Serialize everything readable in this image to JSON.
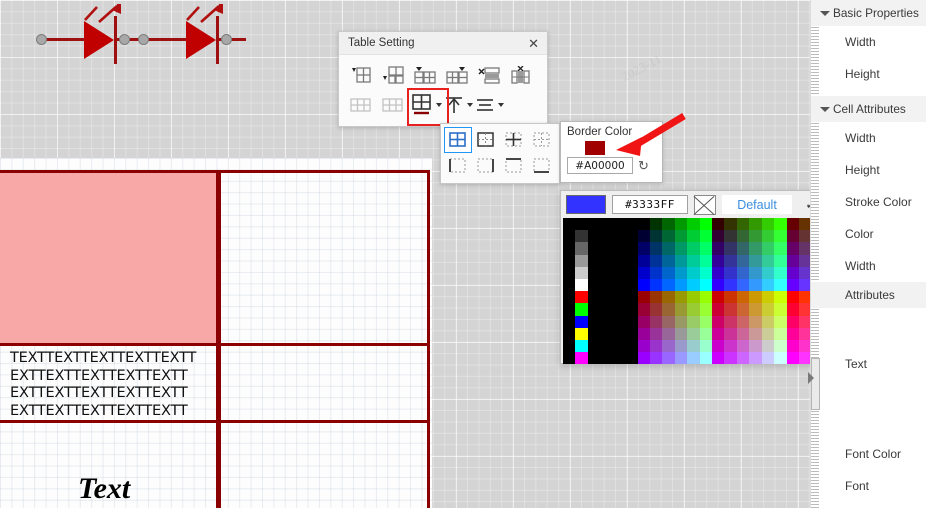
{
  "canvas": {
    "symbols": [
      {
        "name": "led-symbol-1"
      },
      {
        "name": "led-symbol-2"
      }
    ],
    "table": {
      "cell_text": "TEXTTEXTTEXTTEXTTEXTT\nEXTTEXTTEXTTEXTTEXTT\nEXTTEXTTEXTTEXTTEXTT\nEXTTEXTTEXTTEXTTEXTT",
      "cell_text_big": "Text",
      "fill_color": "#f9a8a8",
      "border_color": "#8b0000"
    }
  },
  "dialog": {
    "title": "Table Setting",
    "close_label": "✕",
    "row1": [
      {
        "name": "insert-column-left-icon"
      },
      {
        "name": "insert-row-above-icon"
      },
      {
        "name": "insert-column-right-icon"
      },
      {
        "name": "insert-row-below-icon"
      },
      {
        "name": "delete-row-icon"
      },
      {
        "name": "delete-column-icon"
      }
    ],
    "row2": [
      {
        "name": "merge-cells-icon"
      },
      {
        "name": "split-cells-icon"
      },
      {
        "name": "border-style-icon"
      },
      {
        "name": "vertical-align-icon"
      },
      {
        "name": "horizontal-align-icon"
      }
    ]
  },
  "border_flyout": {
    "options": [
      {
        "name": "border-all-icon",
        "active": true
      },
      {
        "name": "border-outer-icon",
        "active": false
      },
      {
        "name": "border-inner-icon",
        "active": false
      },
      {
        "name": "border-none-icon",
        "active": false
      },
      {
        "name": "border-left-icon",
        "active": false
      },
      {
        "name": "border-right-icon",
        "active": false
      },
      {
        "name": "border-top-icon",
        "active": false
      },
      {
        "name": "border-bottom-icon",
        "active": false
      }
    ]
  },
  "border_color_popup": {
    "label": "Border Color",
    "swatch": "#A00000",
    "hex_value": "#A00000",
    "reset_label": "↻"
  },
  "color_picker": {
    "current_color": "#3333FF",
    "hex_value": "#3333FF",
    "no_color_label": "",
    "default_label": "Default",
    "confirm_label": "✓",
    "cancel_label": "✕",
    "palette_rows": [
      [
        "#000000",
        "#000000",
        "#000000",
        "#000000",
        "#000000",
        "#000000",
        "#000000",
        "#003300",
        "#006600",
        "#009900",
        "#00cc00",
        "#00ff00",
        "#330000",
        "#333300",
        "#336600",
        "#339900",
        "#33cc00",
        "#33ff00",
        "#660000",
        "#663300",
        "#666600",
        "#669900",
        "#66cc00",
        "#66ff00"
      ],
      [
        "#000000",
        "#333333",
        "#000000",
        "#000000",
        "#000000",
        "#000000",
        "#000033",
        "#003333",
        "#006633",
        "#009933",
        "#00cc33",
        "#00ff33",
        "#330033",
        "#333333",
        "#336633",
        "#339933",
        "#33cc33",
        "#33ff33",
        "#660033",
        "#663333",
        "#666633",
        "#669933",
        "#66cc33",
        "#66ff33"
      ],
      [
        "#000000",
        "#666666",
        "#000000",
        "#000000",
        "#000000",
        "#000000",
        "#000066",
        "#003366",
        "#006666",
        "#009966",
        "#00cc66",
        "#00ff66",
        "#330066",
        "#333366",
        "#336666",
        "#339966",
        "#33cc66",
        "#33ff66",
        "#660066",
        "#663366",
        "#666666",
        "#669966",
        "#66cc66",
        "#66ff66"
      ],
      [
        "#000000",
        "#999999",
        "#000000",
        "#000000",
        "#000000",
        "#000000",
        "#000099",
        "#003399",
        "#006699",
        "#009999",
        "#00cc99",
        "#00ff99",
        "#330099",
        "#333399",
        "#336699",
        "#339999",
        "#33cc99",
        "#33ff99",
        "#660099",
        "#663399",
        "#666699",
        "#669999",
        "#66cc99",
        "#66ff99"
      ],
      [
        "#000000",
        "#cccccc",
        "#000000",
        "#000000",
        "#000000",
        "#000000",
        "#0000cc",
        "#0033cc",
        "#0066cc",
        "#0099cc",
        "#00cccc",
        "#00ffcc",
        "#3300cc",
        "#3333cc",
        "#3366cc",
        "#3399cc",
        "#33cccc",
        "#33ffcc",
        "#6600cc",
        "#6633cc",
        "#6666cc",
        "#6699cc",
        "#66cccc",
        "#66ffcc"
      ],
      [
        "#000000",
        "#ffffff",
        "#000000",
        "#000000",
        "#000000",
        "#000000",
        "#0000ff",
        "#0033ff",
        "#0066ff",
        "#0099ff",
        "#00ccff",
        "#00ffff",
        "#3300ff",
        "#3333ff",
        "#3366ff",
        "#3399ff",
        "#33ccff",
        "#33ffff",
        "#6600ff",
        "#6633ff",
        "#6666ff",
        "#6699ff",
        "#66ccff",
        "#66ffff"
      ],
      [
        "#000000",
        "#ff0000",
        "#000000",
        "#000000",
        "#000000",
        "#000000",
        "#990000",
        "#993300",
        "#996600",
        "#999900",
        "#99cc00",
        "#99ff00",
        "#cc0000",
        "#cc3300",
        "#cc6600",
        "#cc9900",
        "#cccc00",
        "#ccff00",
        "#ff0000",
        "#ff3300",
        "#ff6600",
        "#ff9900",
        "#ffcc00",
        "#ffff00"
      ],
      [
        "#000000",
        "#00ff00",
        "#000000",
        "#000000",
        "#000000",
        "#000000",
        "#990033",
        "#993333",
        "#996633",
        "#999933",
        "#99cc33",
        "#99ff33",
        "#cc0033",
        "#cc3333",
        "#cc6633",
        "#cc9933",
        "#cccc33",
        "#ccff33",
        "#ff0033",
        "#ff3333",
        "#ff6633",
        "#ff9933",
        "#ffcc33",
        "#ffff33"
      ],
      [
        "#000000",
        "#0000ff",
        "#000000",
        "#000000",
        "#000000",
        "#000000",
        "#990066",
        "#993366",
        "#996666",
        "#999966",
        "#99cc66",
        "#99ff66",
        "#cc0066",
        "#cc3366",
        "#cc6666",
        "#cc9966",
        "#cccc66",
        "#ccff66",
        "#ff0066",
        "#ff3366",
        "#ff6666",
        "#ff9966",
        "#ffcc66",
        "#ffff66"
      ],
      [
        "#000000",
        "#ffff00",
        "#000000",
        "#000000",
        "#000000",
        "#000000",
        "#990099",
        "#993399",
        "#996699",
        "#999999",
        "#99cc99",
        "#99ff99",
        "#cc0099",
        "#cc3399",
        "#cc6699",
        "#cc9999",
        "#cccc99",
        "#ccff99",
        "#ff0099",
        "#ff3399",
        "#ff6699",
        "#ff9999",
        "#ffcc99",
        "#ffff99"
      ],
      [
        "#000000",
        "#00ffff",
        "#000000",
        "#000000",
        "#000000",
        "#000000",
        "#9900cc",
        "#9933cc",
        "#9966cc",
        "#9999cc",
        "#99cccc",
        "#99ffcc",
        "#cc00cc",
        "#cc33cc",
        "#cc66cc",
        "#cc99cc",
        "#cccccc",
        "#ccffcc",
        "#ff00cc",
        "#ff33cc",
        "#ff66cc",
        "#ff99cc",
        "#ffcccc",
        "#ffffcc"
      ],
      [
        "#000000",
        "#ff00ff",
        "#000000",
        "#000000",
        "#000000",
        "#000000",
        "#9900ff",
        "#9933ff",
        "#9966ff",
        "#9999ff",
        "#99ccff",
        "#99ffff",
        "#cc00ff",
        "#cc33ff",
        "#cc66ff",
        "#cc99ff",
        "#ccccff",
        "#ccffff",
        "#ff00ff",
        "#ff33ff",
        "#ff66ff",
        "#ff99ff",
        "#ffccff",
        "#ffffff"
      ]
    ]
  },
  "properties_panel": {
    "groups": [
      {
        "title": "Basic Properties",
        "items": [
          "Width",
          "Height"
        ]
      },
      {
        "title": "Cell Attributes",
        "items": [
          "Width",
          "Height",
          "Stroke Color",
          "Color",
          "Width",
          "Attributes"
        ]
      }
    ],
    "extra_items": [
      "Text",
      "Font Color",
      "Font"
    ]
  }
}
